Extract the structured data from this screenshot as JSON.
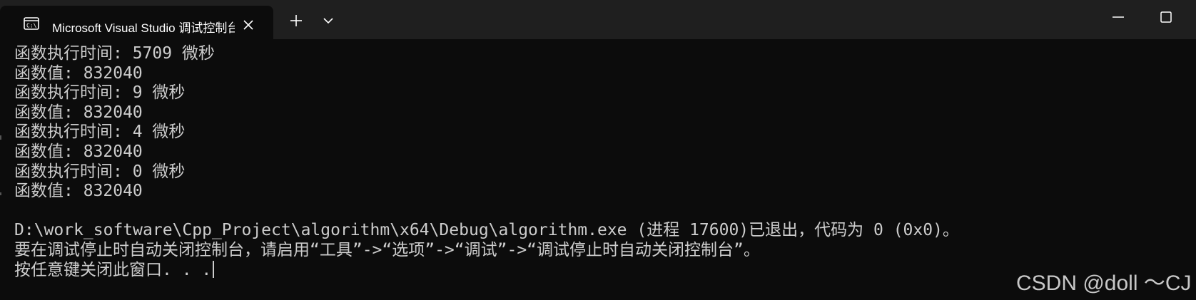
{
  "window": {
    "tab_title": "Microsoft Visual Studio 调试控制台",
    "tab_icon": "console-icon",
    "new_tab_icon": "plus-icon",
    "dropdown_icon": "chevron-down-icon",
    "minimize_icon": "minimize-icon",
    "maximize_icon": "maximize-icon",
    "close_tab_icon": "close-icon"
  },
  "console": {
    "lines": [
      "函数执行时间: 5709 微秒",
      "函数值: 832040",
      "函数执行时间: 9 微秒",
      "函数值: 832040",
      "函数执行时间: 4 微秒",
      "函数值: 832040",
      "函数执行时间: 0 微秒",
      "函数值: 832040",
      "",
      "D:\\work_software\\Cpp_Project\\algorithm\\x64\\Debug\\algorithm.exe (进程 17600)已退出，代码为 0 (0x0)。",
      "要在调试停止时自动关闭控制台，请启用“工具”->“选项”->“调试”->“调试停止时自动关闭控制台”。",
      "按任意键关闭此窗口. . ."
    ]
  },
  "watermark": "CSDN @doll ～CJ",
  "colors": {
    "background": "#0c0c0c",
    "titlebar": "#1f1f1f",
    "text": "#cccccc"
  }
}
